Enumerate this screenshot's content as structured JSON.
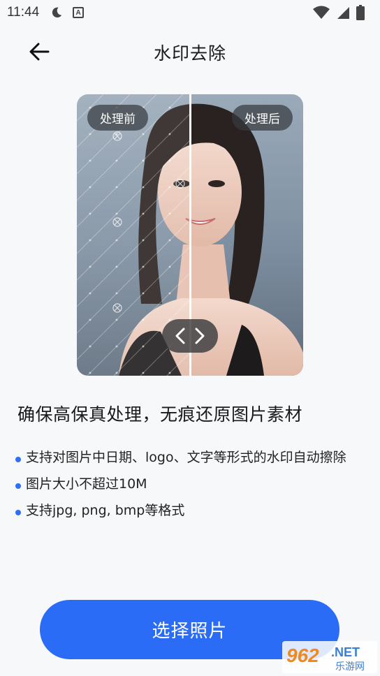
{
  "status_bar": {
    "time": "11:44",
    "icons": [
      "moon-icon",
      "a-icon",
      "wifi-icon",
      "signal-icon",
      "battery-icon"
    ]
  },
  "header": {
    "title": "水印去除",
    "back_icon": "arrow-left-icon"
  },
  "comparison": {
    "before_label": "处理前",
    "after_label": "处理后",
    "handle_icons": [
      "chevron-left-icon",
      "chevron-right-icon"
    ]
  },
  "content": {
    "headline": "确保高保真处理，无痕还原图片素材",
    "features": [
      "支持对图片中日期、logo、文字等形式的水印自动擦除",
      "图片大小不超过10M",
      "支持jpg, png, bmp等格式"
    ]
  },
  "action": {
    "select_photo_label": "选择照片"
  },
  "logo": {
    "text_main": "962",
    "text_net": ".NET",
    "text_cn": "乐游网"
  },
  "colors": {
    "accent": "#2a6cf6",
    "bullet": "#2f6ff7",
    "background": "#f7f8fa"
  }
}
